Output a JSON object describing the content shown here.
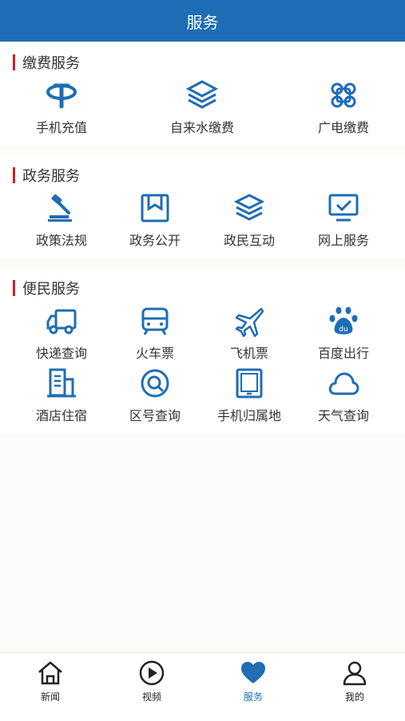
{
  "header": {
    "title": "服务"
  },
  "sections": [
    {
      "title": "缴费服务",
      "items": [
        {
          "label": "手机充值",
          "icon": "telecom-icon"
        },
        {
          "label": "自来水缴费",
          "icon": "water-layers-icon"
        },
        {
          "label": "广电缴费",
          "icon": "unicom-knot-icon"
        }
      ]
    },
    {
      "title": "政务服务",
      "items": [
        {
          "label": "政策法规",
          "icon": "gavel-icon"
        },
        {
          "label": "政务公开",
          "icon": "bookmark-doc-icon"
        },
        {
          "label": "政民互动",
          "icon": "layers-icon"
        },
        {
          "label": "网上服务",
          "icon": "monitor-check-icon"
        }
      ]
    },
    {
      "title": "便民服务",
      "items": [
        {
          "label": "快递查询",
          "icon": "truck-icon"
        },
        {
          "label": "火车票",
          "icon": "train-icon"
        },
        {
          "label": "飞机票",
          "icon": "airplane-icon"
        },
        {
          "label": "百度出行",
          "icon": "baidu-paw-icon"
        },
        {
          "label": "酒店住宿",
          "icon": "building-icon"
        },
        {
          "label": "区号查询",
          "icon": "search-circle-icon"
        },
        {
          "label": "手机归属地",
          "icon": "tablet-icon"
        },
        {
          "label": "天气查询",
          "icon": "cloud-icon"
        }
      ]
    }
  ],
  "tabbar": {
    "items": [
      {
        "label": "新闻",
        "icon": "home-icon"
      },
      {
        "label": "视频",
        "icon": "play-icon"
      },
      {
        "label": "服务",
        "icon": "heart-icon"
      },
      {
        "label": "我的",
        "icon": "user-icon"
      }
    ],
    "active_color": "#1e6db5"
  },
  "colors": {
    "header": "#1e6db5",
    "accent_bar": "#c8202a",
    "icon": "#1e6db5"
  }
}
